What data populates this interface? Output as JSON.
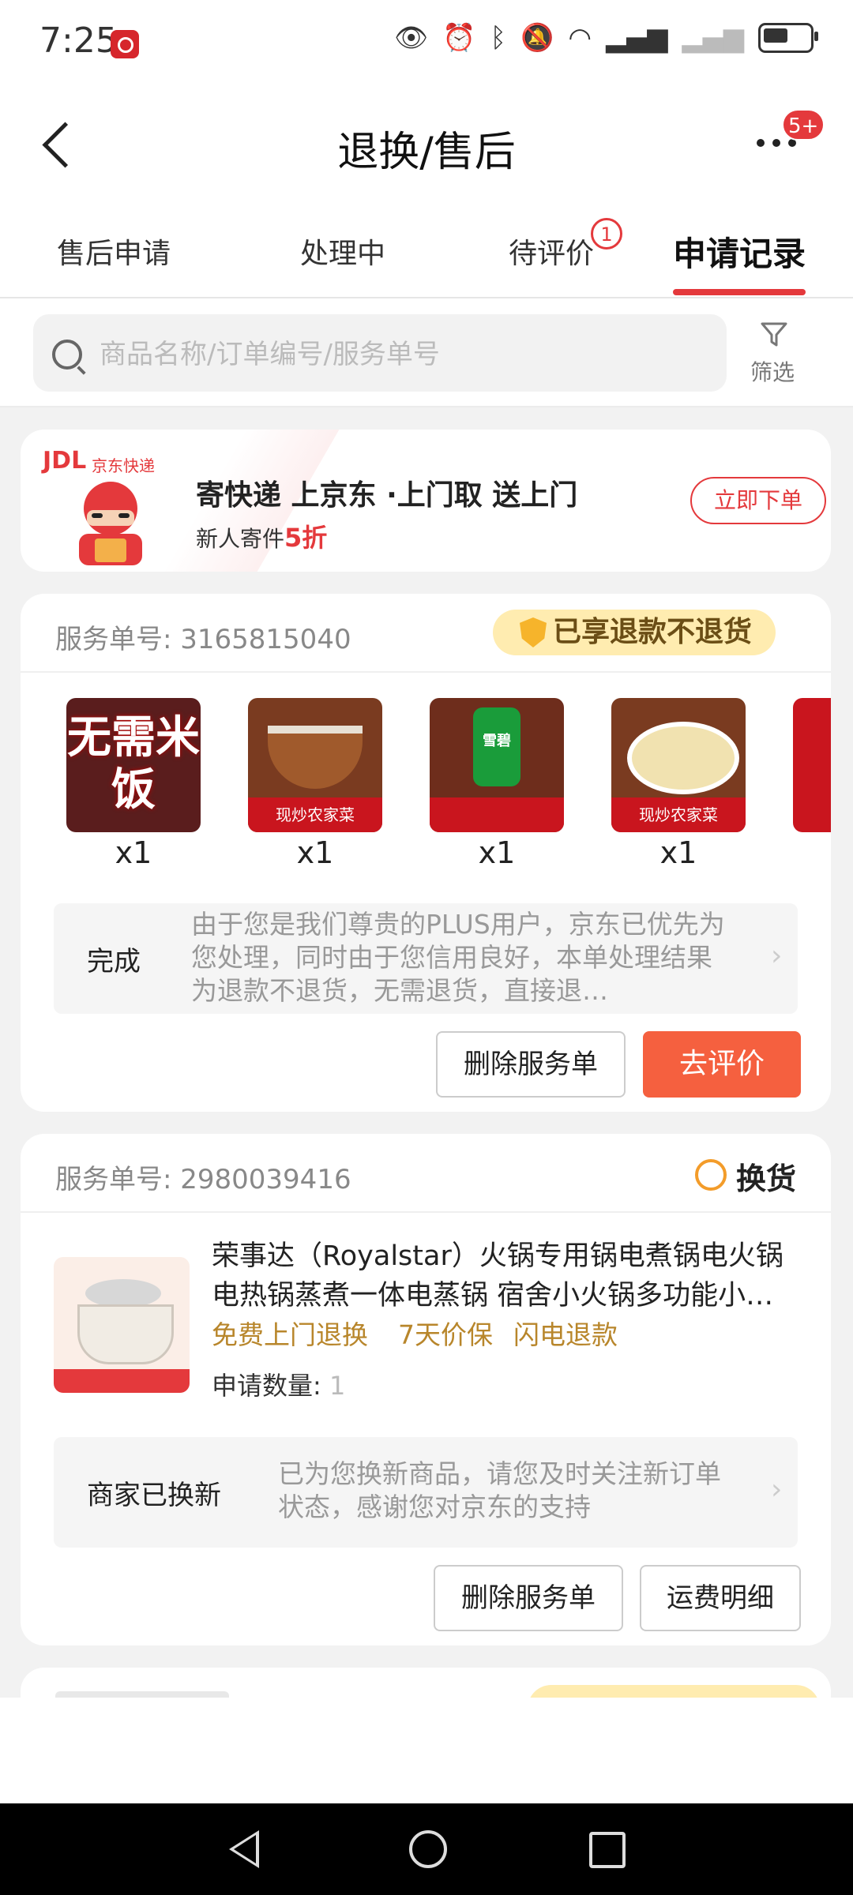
{
  "status_bar": {
    "time": "7:25"
  },
  "header": {
    "title": "退换/售后",
    "more_badge": "5+"
  },
  "tabs": [
    {
      "label": "售后申请"
    },
    {
      "label": "处理中"
    },
    {
      "label": "待评价",
      "badge": "1"
    },
    {
      "label": "申请记录",
      "active": true
    }
  ],
  "search": {
    "placeholder": "商品名称/订单编号/服务单号",
    "filter_label": "筛选"
  },
  "ad": {
    "logo": "JDL",
    "logo_cn": "京东快递",
    "title": "寄快递 上京东 ·上门取 送上门",
    "subtitle_prefix": "新人寄件",
    "discount": "5折",
    "button": "立即下单"
  },
  "service_1": {
    "number_label": "服务单号: 3165815040",
    "badge": "已享退款不退货",
    "items": [
      {
        "thumb": "无需米饭",
        "qty": "x1"
      },
      {
        "thumb": "现炒农家菜",
        "qty": "x1"
      },
      {
        "thumb": "雪碧",
        "qty": "x1"
      },
      {
        "thumb": "现炒农家菜",
        "qty": "x1"
      }
    ],
    "status": "完成",
    "note": "由于您是我们尊贵的PLUS用户，京东已优先为您处理，同时由于您信用良好，本单处理结果为退款不退货，无需退货，直接退…",
    "btn_delete": "删除服务单",
    "btn_review": "去评价"
  },
  "service_2": {
    "number_label": "服务单号: 2980039416",
    "type": "换货",
    "product_title": "荣事达（Royalstar）火锅专用锅电煮锅电火锅电热锅蒸煮一体电蒸锅 宿舍小火锅多功能小…",
    "tags": [
      "免费上门退换",
      "7天价保",
      "闪电退款"
    ],
    "qty_label": "申请数量: ",
    "qty_value": "1",
    "status": "商家已换新",
    "note": "已为您换新商品，请您及时关注新订单状态，感谢您对京东的支持",
    "btn_delete": "删除服务单",
    "btn_freight": "运费明细"
  },
  "colors": {
    "accent": "#e4393c",
    "primary_button": "#f5603f",
    "badge_bg": "#ffecb0",
    "tag": "#b8862b"
  }
}
